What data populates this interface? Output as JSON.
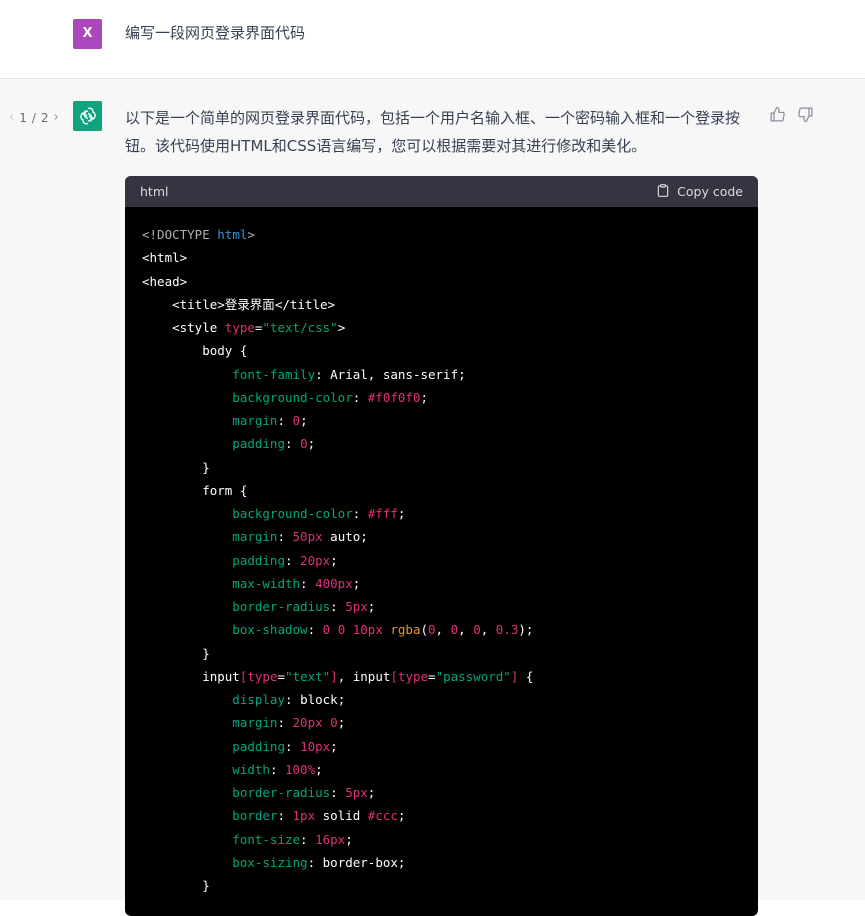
{
  "user": {
    "avatar_letter": "X",
    "avatar_color": "#ab47bc",
    "message": "编写一段网页登录界面代码"
  },
  "assistant": {
    "pager": {
      "current": "1",
      "total": "2",
      "separator": "/"
    },
    "avatar_icon": "chatgpt-logo-icon",
    "avatar_color": "#10a37f",
    "text": "以下是一个简单的网页登录界面代码，包括一个用户名输入框、一个密码输入框和一个登录按钮。该代码使用HTML和CSS语言编写，您可以根据需要对其进行修改和美化。",
    "feedback": [
      "thumbs-up-icon",
      "thumbs-down-icon"
    ]
  },
  "code_block": {
    "language": "html",
    "copy_label": "Copy code",
    "lines": [
      [
        [
          "t-meta",
          "<!DOCTYPE "
        ],
        [
          "t-name",
          "html"
        ],
        [
          "t-meta",
          ">"
        ]
      ],
      [
        [
          "t-tag",
          "<html>"
        ]
      ],
      [
        [
          "t-tag",
          "<head>"
        ]
      ],
      [
        [
          "t-tag",
          "    <title>"
        ],
        [
          "t-tag",
          "登录界面"
        ],
        [
          "t-tag",
          "</title>"
        ]
      ],
      [
        [
          "t-tag",
          "    <style "
        ],
        [
          "t-attr",
          "type"
        ],
        [
          "t-tag",
          "="
        ],
        [
          "t-str",
          "\"text/css\""
        ],
        [
          "t-tag",
          ">"
        ]
      ],
      [
        [
          "t-sel",
          "        body "
        ],
        [
          "t-punc",
          "{"
        ]
      ],
      [
        [
          "t-prop",
          "            font-family"
        ],
        [
          "t-punc",
          ": "
        ],
        [
          "t-kw",
          "Arial, sans-serif"
        ],
        [
          "t-punc",
          ";"
        ]
      ],
      [
        [
          "t-prop",
          "            background-color"
        ],
        [
          "t-punc",
          ": "
        ],
        [
          "t-num",
          "#f0f0f0"
        ],
        [
          "t-punc",
          ";"
        ]
      ],
      [
        [
          "t-prop",
          "            margin"
        ],
        [
          "t-punc",
          ": "
        ],
        [
          "t-num",
          "0"
        ],
        [
          "t-punc",
          ";"
        ]
      ],
      [
        [
          "t-prop",
          "            padding"
        ],
        [
          "t-punc",
          ": "
        ],
        [
          "t-num",
          "0"
        ],
        [
          "t-punc",
          ";"
        ]
      ],
      [
        [
          "t-punc",
          "        }"
        ]
      ],
      [
        [
          "t-sel",
          "        form "
        ],
        [
          "t-punc",
          "{"
        ]
      ],
      [
        [
          "t-prop",
          "            background-color"
        ],
        [
          "t-punc",
          ": "
        ],
        [
          "t-num",
          "#fff"
        ],
        [
          "t-punc",
          ";"
        ]
      ],
      [
        [
          "t-prop",
          "            margin"
        ],
        [
          "t-punc",
          ": "
        ],
        [
          "t-num",
          "50px"
        ],
        [
          "t-kw",
          " auto"
        ],
        [
          "t-punc",
          ";"
        ]
      ],
      [
        [
          "t-prop",
          "            padding"
        ],
        [
          "t-punc",
          ": "
        ],
        [
          "t-num",
          "20px"
        ],
        [
          "t-punc",
          ";"
        ]
      ],
      [
        [
          "t-prop",
          "            max-width"
        ],
        [
          "t-punc",
          ": "
        ],
        [
          "t-num",
          "400px"
        ],
        [
          "t-punc",
          ";"
        ]
      ],
      [
        [
          "t-prop",
          "            border-radius"
        ],
        [
          "t-punc",
          ": "
        ],
        [
          "t-num",
          "5px"
        ],
        [
          "t-punc",
          ";"
        ]
      ],
      [
        [
          "t-prop",
          "            box-shadow"
        ],
        [
          "t-punc",
          ": "
        ],
        [
          "t-num",
          "0 0 10px "
        ],
        [
          "t-fn",
          "rgba"
        ],
        [
          "t-punc",
          "("
        ],
        [
          "t-num",
          "0"
        ],
        [
          "t-punc",
          ", "
        ],
        [
          "t-num",
          "0"
        ],
        [
          "t-punc",
          ", "
        ],
        [
          "t-num",
          "0"
        ],
        [
          "t-punc",
          ", "
        ],
        [
          "t-num",
          "0.3"
        ],
        [
          "t-punc",
          ");"
        ]
      ],
      [
        [
          "t-punc",
          "        }"
        ]
      ],
      [
        [
          "t-sel",
          "        input"
        ],
        [
          "t-sep",
          "["
        ],
        [
          "t-attr",
          "type"
        ],
        [
          "t-punc",
          "="
        ],
        [
          "t-str",
          "\"text\""
        ],
        [
          "t-sep",
          "]"
        ],
        [
          "t-sel",
          ", input"
        ],
        [
          "t-sep",
          "["
        ],
        [
          "t-attr",
          "type"
        ],
        [
          "t-punc",
          "="
        ],
        [
          "t-str",
          "\"password\""
        ],
        [
          "t-sep",
          "]"
        ],
        [
          "t-punc",
          " {"
        ]
      ],
      [
        [
          "t-prop",
          "            display"
        ],
        [
          "t-punc",
          ": "
        ],
        [
          "t-kw",
          "block"
        ],
        [
          "t-punc",
          ";"
        ]
      ],
      [
        [
          "t-prop",
          "            margin"
        ],
        [
          "t-punc",
          ": "
        ],
        [
          "t-num",
          "20px 0"
        ],
        [
          "t-punc",
          ";"
        ]
      ],
      [
        [
          "t-prop",
          "            padding"
        ],
        [
          "t-punc",
          ": "
        ],
        [
          "t-num",
          "10px"
        ],
        [
          "t-punc",
          ";"
        ]
      ],
      [
        [
          "t-prop",
          "            width"
        ],
        [
          "t-punc",
          ": "
        ],
        [
          "t-num",
          "100%"
        ],
        [
          "t-punc",
          ";"
        ]
      ],
      [
        [
          "t-prop",
          "            border-radius"
        ],
        [
          "t-punc",
          ": "
        ],
        [
          "t-num",
          "5px"
        ],
        [
          "t-punc",
          ";"
        ]
      ],
      [
        [
          "t-prop",
          "            border"
        ],
        [
          "t-punc",
          ": "
        ],
        [
          "t-num",
          "1px"
        ],
        [
          "t-kw",
          " solid "
        ],
        [
          "t-num",
          "#ccc"
        ],
        [
          "t-punc",
          ";"
        ]
      ],
      [
        [
          "t-prop",
          "            font-size"
        ],
        [
          "t-punc",
          ": "
        ],
        [
          "t-num",
          "16px"
        ],
        [
          "t-punc",
          ";"
        ]
      ],
      [
        [
          "t-prop",
          "            box-sizing"
        ],
        [
          "t-punc",
          ": "
        ],
        [
          "t-kw",
          "border-box"
        ],
        [
          "t-punc",
          ";"
        ]
      ],
      [
        [
          "t-punc",
          "        }"
        ]
      ]
    ]
  }
}
